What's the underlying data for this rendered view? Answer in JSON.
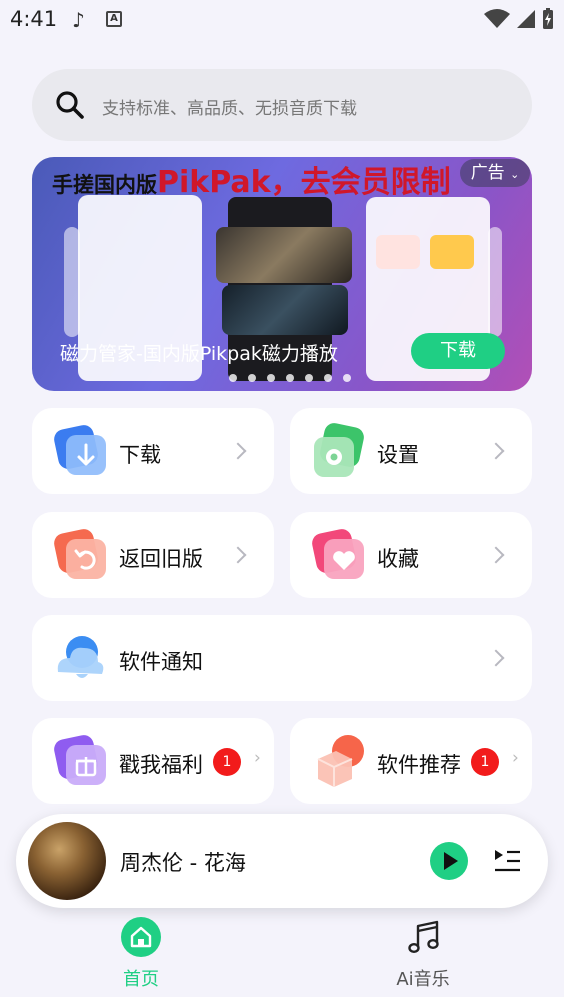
{
  "status": {
    "time": "4:41"
  },
  "search": {
    "placeholder": "支持标准、高品质、无损音质下载"
  },
  "banner": {
    "headline_prefix": "手搓国内版",
    "headline_brand": "PikPak，去会员限制",
    "ad_label": "广告",
    "caption": "磁力管家-国内版Pikpak磁力播放",
    "button_label": "下载",
    "dots": 7
  },
  "menu": {
    "download": "下载",
    "settings": "设置",
    "back_old": "返回旧版",
    "favorites": "收藏",
    "notice": "软件通知",
    "welfare": "戳我福利",
    "welfare_badge": "1",
    "recommend": "软件推荐",
    "recommend_badge": "1"
  },
  "player": {
    "song": "周杰伦 - 花海"
  },
  "tabs": [
    {
      "label": "首页",
      "active": true
    },
    {
      "label": "Ai音乐",
      "active": false
    }
  ],
  "colors": {
    "accent": "#1fcf84",
    "badge": "#f21b1b",
    "background": "#f4f3fb"
  }
}
